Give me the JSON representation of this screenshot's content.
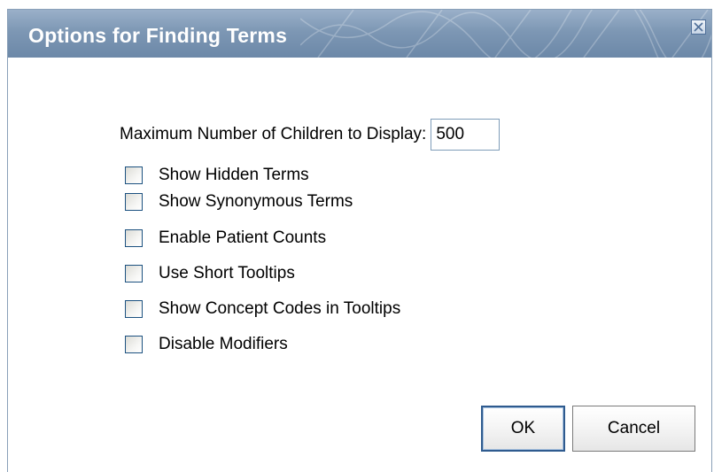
{
  "dialog": {
    "title": "Options for Finding Terms",
    "close_icon": "close-icon"
  },
  "max_children": {
    "label": "Maximum Number of Children to Display:",
    "value": "500"
  },
  "options": [
    {
      "label": "Show Hidden Terms",
      "checked": false
    },
    {
      "label": "Show Synonymous Terms",
      "checked": false
    },
    {
      "label": "Enable Patient Counts",
      "checked": false
    },
    {
      "label": "Use Short Tooltips",
      "checked": false
    },
    {
      "label": "Show Concept Codes in Tooltips",
      "checked": false
    },
    {
      "label": "Disable Modifiers",
      "checked": false
    }
  ],
  "buttons": {
    "ok_label": "OK",
    "cancel_label": "Cancel"
  },
  "colors": {
    "titlebar": "#7d97b4",
    "title_text": "#ffffff",
    "checkbox_border": "#1c5180",
    "ok_border": "#2f5b8f"
  }
}
